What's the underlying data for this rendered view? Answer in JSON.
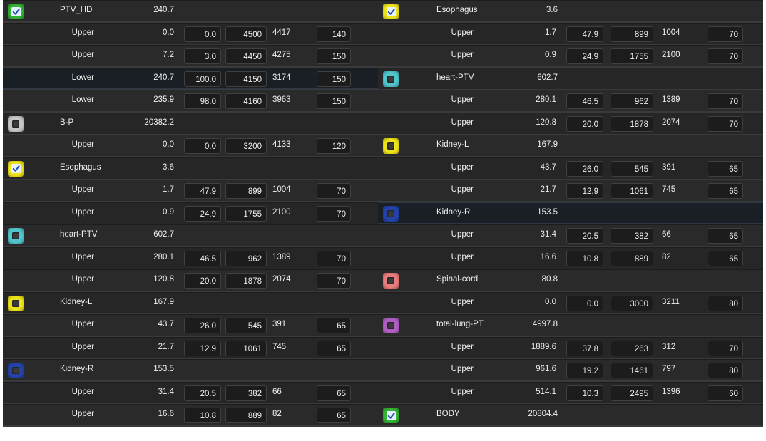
{
  "colors": {
    "green": "#33b233",
    "gray": "#c8c8c8",
    "yellow": "#ece31a",
    "cyan": "#52c4cc",
    "blue": "#2442a8",
    "salmon": "#e87b7b",
    "magenta": "#b05ec4"
  },
  "left": [
    {
      "type": "structure",
      "name": "PTV_HD",
      "volume": "240.7",
      "color": "#33b233",
      "checked": true
    },
    {
      "type": "objective",
      "label": "Upper",
      "volume": "0.0",
      "percent": "0.0",
      "dose": "4500",
      "achieved": "4417",
      "weight": "140"
    },
    {
      "type": "objective",
      "label": "Upper",
      "volume": "7.2",
      "percent": "3.0",
      "dose": "4450",
      "achieved": "4275",
      "weight": "150"
    },
    {
      "type": "objective",
      "label": "Lower",
      "volume": "240.7",
      "percent": "100.0",
      "dose": "4150",
      "achieved": "3174",
      "weight": "150",
      "highlight": true
    },
    {
      "type": "objective",
      "label": "Lower",
      "volume": "235.9",
      "percent": "98.0",
      "dose": "4160",
      "achieved": "3963",
      "weight": "150"
    },
    {
      "type": "structure",
      "name": "B-P",
      "volume": "20382.2",
      "color": "#c8c8c8",
      "checked": false
    },
    {
      "type": "objective",
      "label": "Upper",
      "volume": "0.0",
      "percent": "0.0",
      "dose": "3200",
      "achieved": "4133",
      "weight": "120"
    },
    {
      "type": "structure",
      "name": "Esophagus",
      "volume": "3.6",
      "color": "#ece31a",
      "checked": true
    },
    {
      "type": "objective",
      "label": "Upper",
      "volume": "1.7",
      "percent": "47.9",
      "dose": "899",
      "achieved": "1004",
      "weight": "70"
    },
    {
      "type": "objective",
      "label": "Upper",
      "volume": "0.9",
      "percent": "24.9",
      "dose": "1755",
      "achieved": "2100",
      "weight": "70"
    },
    {
      "type": "structure",
      "name": "heart-PTV",
      "volume": "602.7",
      "color": "#52c4cc",
      "checked": false
    },
    {
      "type": "objective",
      "label": "Upper",
      "volume": "280.1",
      "percent": "46.5",
      "dose": "962",
      "achieved": "1389",
      "weight": "70"
    },
    {
      "type": "objective",
      "label": "Upper",
      "volume": "120.8",
      "percent": "20.0",
      "dose": "1878",
      "achieved": "2074",
      "weight": "70"
    },
    {
      "type": "structure",
      "name": "Kidney-L",
      "volume": "167.9",
      "color": "#ece31a",
      "checked": false
    },
    {
      "type": "objective",
      "label": "Upper",
      "volume": "43.7",
      "percent": "26.0",
      "dose": "545",
      "achieved": "391",
      "weight": "65"
    },
    {
      "type": "objective",
      "label": "Upper",
      "volume": "21.7",
      "percent": "12.9",
      "dose": "1061",
      "achieved": "745",
      "weight": "65"
    },
    {
      "type": "structure",
      "name": "Kidney-R",
      "volume": "153.5",
      "color": "#2442a8",
      "checked": false
    },
    {
      "type": "objective",
      "label": "Upper",
      "volume": "31.4",
      "percent": "20.5",
      "dose": "382",
      "achieved": "66",
      "weight": "65"
    },
    {
      "type": "objective",
      "label": "Upper",
      "volume": "16.6",
      "percent": "10.8",
      "dose": "889",
      "achieved": "82",
      "weight": "65"
    }
  ],
  "right": [
    {
      "type": "structure",
      "name": "Esophagus",
      "volume": "3.6",
      "color": "#ece31a",
      "checked": true
    },
    {
      "type": "objective",
      "label": "Upper",
      "volume": "1.7",
      "percent": "47.9",
      "dose": "899",
      "achieved": "1004",
      "weight": "70"
    },
    {
      "type": "objective",
      "label": "Upper",
      "volume": "0.9",
      "percent": "24.9",
      "dose": "1755",
      "achieved": "2100",
      "weight": "70"
    },
    {
      "type": "structure",
      "name": "heart-PTV",
      "volume": "602.7",
      "color": "#52c4cc",
      "checked": false
    },
    {
      "type": "objective",
      "label": "Upper",
      "volume": "280.1",
      "percent": "46.5",
      "dose": "962",
      "achieved": "1389",
      "weight": "70"
    },
    {
      "type": "objective",
      "label": "Upper",
      "volume": "120.8",
      "percent": "20.0",
      "dose": "1878",
      "achieved": "2074",
      "weight": "70"
    },
    {
      "type": "structure",
      "name": "Kidney-L",
      "volume": "167.9",
      "color": "#ece31a",
      "checked": false
    },
    {
      "type": "objective",
      "label": "Upper",
      "volume": "43.7",
      "percent": "26.0",
      "dose": "545",
      "achieved": "391",
      "weight": "65"
    },
    {
      "type": "objective",
      "label": "Upper",
      "volume": "21.7",
      "percent": "12.9",
      "dose": "1061",
      "achieved": "745",
      "weight": "65"
    },
    {
      "type": "structure",
      "name": "Kidney-R",
      "volume": "153.5",
      "color": "#2442a8",
      "checked": false,
      "highlight": true
    },
    {
      "type": "objective",
      "label": "Upper",
      "volume": "31.4",
      "percent": "20.5",
      "dose": "382",
      "achieved": "66",
      "weight": "65"
    },
    {
      "type": "objective",
      "label": "Upper",
      "volume": "16.6",
      "percent": "10.8",
      "dose": "889",
      "achieved": "82",
      "weight": "65"
    },
    {
      "type": "structure",
      "name": "Spinal-cord",
      "volume": "80.8",
      "color": "#e87b7b",
      "checked": false
    },
    {
      "type": "objective",
      "label": "Upper",
      "volume": "0.0",
      "percent": "0.0",
      "dose": "3000",
      "achieved": "3211",
      "weight": "80"
    },
    {
      "type": "structure",
      "name": "total-lung-PT",
      "volume": "4997.8",
      "color": "#b05ec4",
      "checked": false
    },
    {
      "type": "objective",
      "label": "Upper",
      "volume": "1889.6",
      "percent": "37.8",
      "dose": "263",
      "achieved": "312",
      "weight": "70"
    },
    {
      "type": "objective",
      "label": "Upper",
      "volume": "961.6",
      "percent": "19.2",
      "dose": "1461",
      "achieved": "797",
      "weight": "80"
    },
    {
      "type": "objective",
      "label": "Upper",
      "volume": "514.1",
      "percent": "10.3",
      "dose": "2495",
      "achieved": "1396",
      "weight": "60"
    },
    {
      "type": "structure",
      "name": "BODY",
      "volume": "20804.4",
      "color": "#33b233",
      "checked": true
    }
  ]
}
